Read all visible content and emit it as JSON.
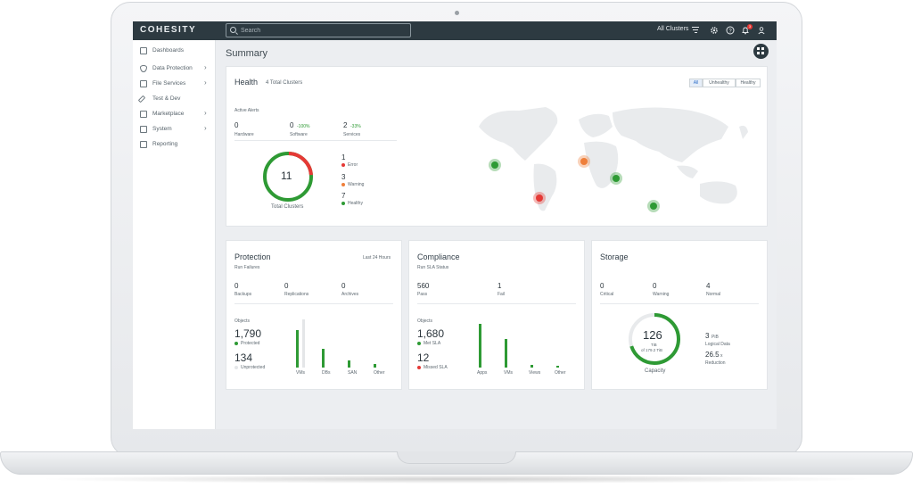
{
  "app": {
    "logo": "COHESITY"
  },
  "topbar": {
    "search_placeholder": "Search",
    "clusters_label": "All Clusters",
    "alert_count": "3"
  },
  "sidebar": {
    "items": [
      {
        "label": "Dashboards",
        "icon": "grid-icon",
        "has_chevron": false
      },
      {
        "label": "Data Protection",
        "icon": "shield-icon",
        "has_chevron": true
      },
      {
        "label": "File Services",
        "icon": "folder-icon",
        "has_chevron": true
      },
      {
        "label": "Test & Dev",
        "icon": "wrench-icon",
        "has_chevron": false
      },
      {
        "label": "Marketplace",
        "icon": "store-icon",
        "has_chevron": true
      },
      {
        "label": "System",
        "icon": "cube-icon",
        "has_chevron": true
      },
      {
        "label": "Reporting",
        "icon": "report-icon",
        "has_chevron": false
      }
    ]
  },
  "page": {
    "title": "Summary"
  },
  "health": {
    "title": "Health",
    "subtitle": "4 Total Clusters",
    "filters": [
      "All",
      "Unhealthy",
      "Healthy"
    ],
    "active_filter": "All",
    "active_alerts_label": "Active Alerts",
    "alerts": [
      {
        "value": "0",
        "label": "Hardware",
        "change": ""
      },
      {
        "value": "0",
        "label": "Software",
        "change": "-100%"
      },
      {
        "value": "2",
        "label": "Services",
        "change": "-33%"
      }
    ],
    "total": "11",
    "total_label": "Total Clusters",
    "breakdown": [
      {
        "value": "1",
        "label": "Error",
        "color": "#e53935"
      },
      {
        "value": "3",
        "label": "Warning",
        "color": "#ef7f3a"
      },
      {
        "value": "7",
        "label": "Healthy",
        "color": "#2e9a34"
      }
    ],
    "map_markers": [
      "#2e9a34",
      "#ef7f3a",
      "#e53935",
      "#2e9a34",
      "#2e9a34"
    ]
  },
  "protection": {
    "title": "Protection",
    "period": "Last 24 Hours",
    "run_failures_label": "Run Failures",
    "failures": [
      {
        "value": "0",
        "label": "Backups"
      },
      {
        "value": "0",
        "label": "Replications"
      },
      {
        "value": "0",
        "label": "Archives"
      }
    ],
    "objects_label": "Objects",
    "protected_value": "1,790",
    "protected_label": "Protected",
    "unprotected_value": "134",
    "unprotected_label": "Unprotected",
    "chart_categories": [
      "VMs",
      "DBs",
      "SAN",
      "Other"
    ]
  },
  "compliance": {
    "title": "Compliance",
    "run_sla_label": "Run SLA Status",
    "sla": [
      {
        "value": "560",
        "label": "Pass"
      },
      {
        "value": "1",
        "label": "Fail"
      }
    ],
    "objects_label": "Objects",
    "met_value": "1,680",
    "met_label": "Met SLA",
    "missed_value": "12",
    "missed_label": "Missed SLA",
    "chart_categories": [
      "Apps",
      "VMs",
      "Views",
      "Other"
    ]
  },
  "storage": {
    "title": "Storage",
    "stats": [
      {
        "value": "0",
        "label": "Critical"
      },
      {
        "value": "0",
        "label": "Warning"
      },
      {
        "value": "4",
        "label": "Normal"
      }
    ],
    "capacity_value": "126",
    "capacity_unit": "TiB",
    "capacity_of": "of 179.2 TiB",
    "capacity_label": "Capacity",
    "logical_value": "3",
    "logical_unit": "PiB",
    "logical_label": "Logical Data",
    "reduction_value": "26.5",
    "reduction_unit": "x",
    "reduction_label": "Reduction",
    "used_fraction": 0.7
  },
  "colors": {
    "accent": "#2e9a34",
    "error": "#e53935",
    "warning": "#ef7f3a",
    "topbar": "#2d3a41"
  }
}
